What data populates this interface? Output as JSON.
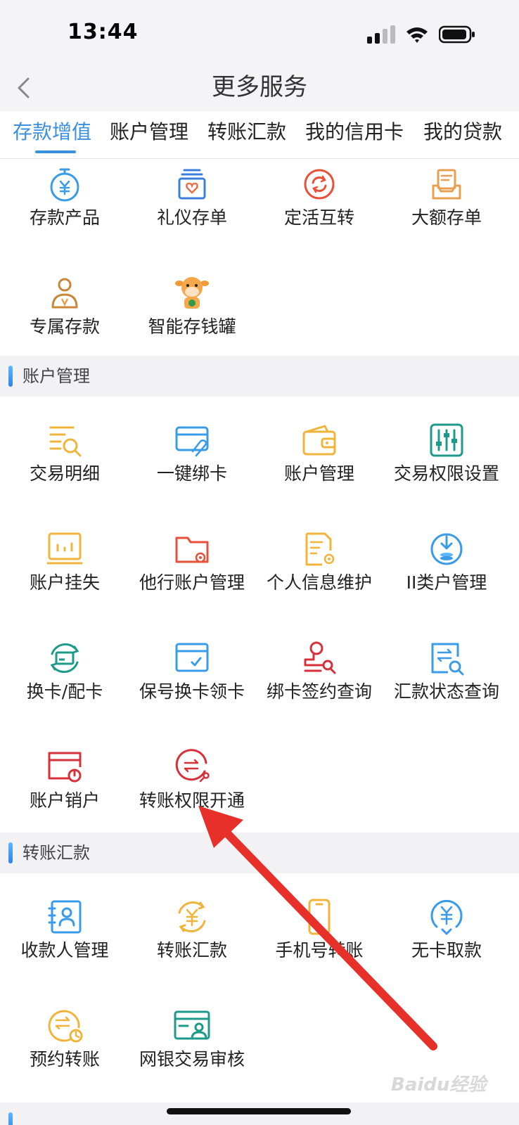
{
  "status": {
    "time": "13:44"
  },
  "nav": {
    "title": "更多服务"
  },
  "tabs": [
    "存款增值",
    "账户管理",
    "转账汇款",
    "我的信用卡",
    "我的贷款"
  ],
  "deposit": {
    "items": [
      "存款产品",
      "礼仪存单",
      "定活互转",
      "大额存单",
      "专属存款",
      "智能存钱罐"
    ]
  },
  "account": {
    "title": "账户管理",
    "items": [
      "交易明细",
      "一键绑卡",
      "账户管理",
      "交易权限设置",
      "账户挂失",
      "他行账户管理",
      "个人信息维护",
      "II类户管理",
      "换卡/配卡",
      "保号换卡领卡",
      "绑卡签约查询",
      "汇款状态查询",
      "账户销户",
      "转账权限开通"
    ]
  },
  "transfer": {
    "title": "转账汇款",
    "items": [
      "收款人管理",
      "转账汇款",
      "手机号转账",
      "无卡取款",
      "预约转账",
      "网银交易审核"
    ]
  },
  "watermark": "Baidu经验",
  "colors": {
    "accent": "#3a8fe0",
    "arrow": "#e8302a"
  }
}
